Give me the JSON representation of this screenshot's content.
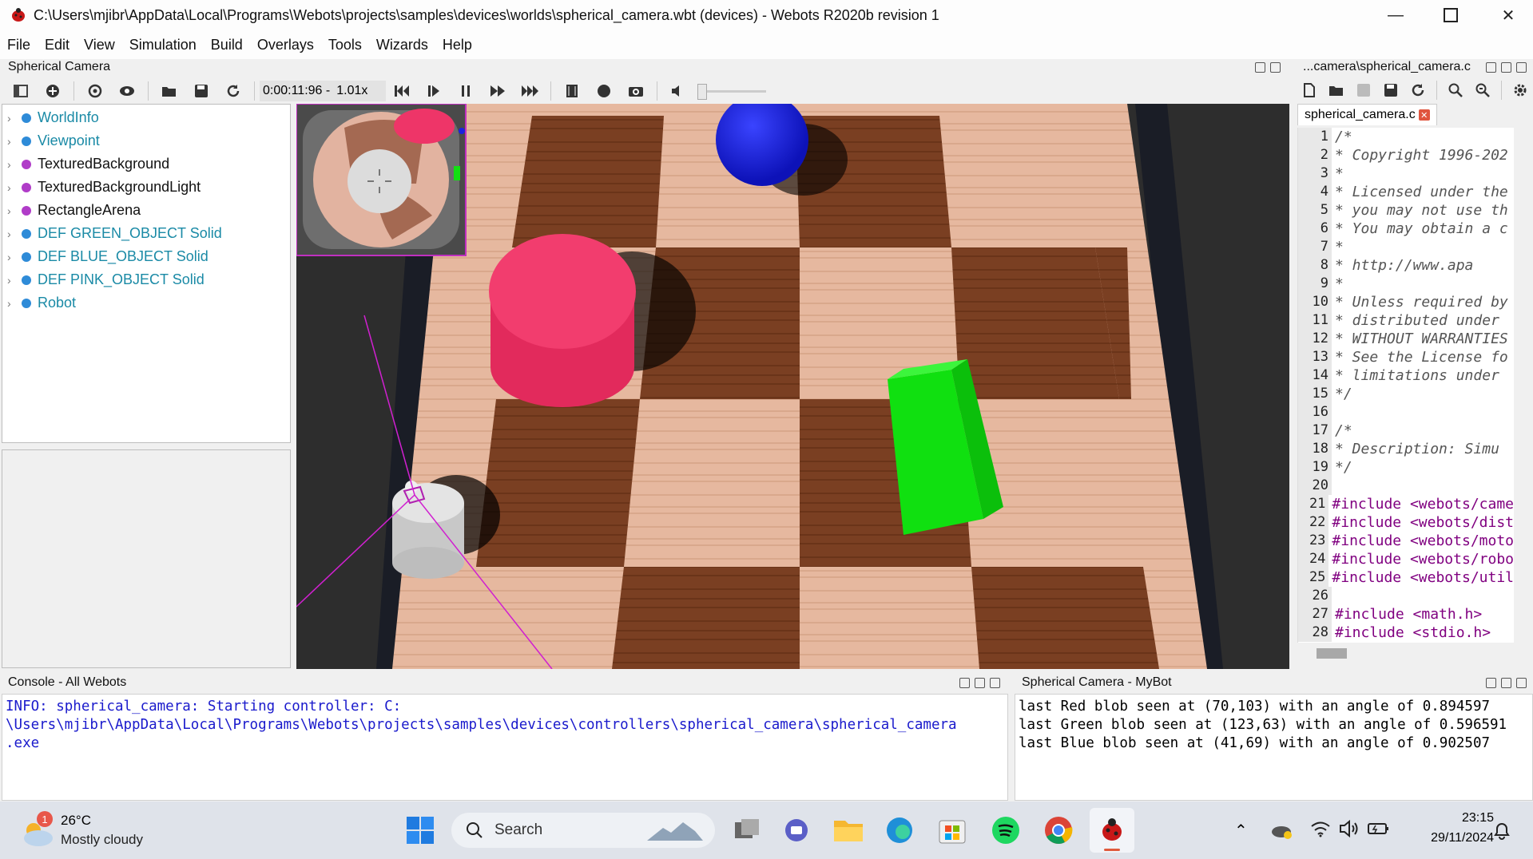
{
  "window": {
    "title": "C:\\Users\\mjibr\\AppData\\Local\\Programs\\Webots\\projects\\samples\\devices\\worlds\\spherical_camera.wbt (devices) - Webots R2020b revision 1",
    "minimize_icon": "minimize-icon",
    "maximize_icon": "maximize-icon",
    "close_icon": "close-icon"
  },
  "menu": [
    "File",
    "Edit",
    "View",
    "Simulation",
    "Build",
    "Overlays",
    "Tools",
    "Wizards",
    "Help"
  ],
  "scene_panel": {
    "title": "Spherical Camera",
    "sim_time": "0:00:11:96 -",
    "speed": "1.01x"
  },
  "scene_tree": [
    {
      "label": "WorldInfo",
      "color": "#1a8aa6",
      "dot": "#2e8bd8"
    },
    {
      "label": "Viewpoint",
      "color": "#1a8aa6",
      "dot": "#2e8bd8"
    },
    {
      "label": "TexturedBackground",
      "color": "#111111",
      "dot": "#b03cc8"
    },
    {
      "label": "TexturedBackgroundLight",
      "color": "#111111",
      "dot": "#b03cc8"
    },
    {
      "label": "RectangleArena",
      "color": "#111111",
      "dot": "#b03cc8"
    },
    {
      "label": "DEF GREEN_OBJECT Solid",
      "color": "#1a8aa6",
      "dot": "#2e8bd8"
    },
    {
      "label": "DEF BLUE_OBJECT Solid",
      "color": "#1a8aa6",
      "dot": "#2e8bd8"
    },
    {
      "label": "DEF PINK_OBJECT Solid",
      "color": "#1a8aa6",
      "dot": "#2e8bd8"
    },
    {
      "label": "Robot",
      "color": "#1a8aa6",
      "dot": "#2e8bd8"
    }
  ],
  "editor_panel": {
    "title": "...camera\\spherical_camera.c",
    "tab": "spherical_camera.c",
    "lines": [
      {
        "n": "1",
        "text": "/*",
        "kind": "comment"
      },
      {
        "n": "2",
        "text": " * Copyright 1996-202",
        "kind": "comment"
      },
      {
        "n": "3",
        "text": " *",
        "kind": "comment"
      },
      {
        "n": "4",
        "text": " * Licensed under the",
        "kind": "comment"
      },
      {
        "n": "5",
        "text": " * you may not use th",
        "kind": "comment"
      },
      {
        "n": "6",
        "text": " * You may obtain a c",
        "kind": "comment"
      },
      {
        "n": "7",
        "text": " *",
        "kind": "comment"
      },
      {
        "n": "8",
        "text": " *     http://www.apa",
        "kind": "comment"
      },
      {
        "n": "9",
        "text": " *",
        "kind": "comment"
      },
      {
        "n": "10",
        "text": " * Unless required by",
        "kind": "comment"
      },
      {
        "n": "11",
        "text": " * distributed under",
        "kind": "comment"
      },
      {
        "n": "12",
        "text": " * WITHOUT WARRANTIES",
        "kind": "comment"
      },
      {
        "n": "13",
        "text": " * See the License fo",
        "kind": "comment"
      },
      {
        "n": "14",
        "text": " * limitations under",
        "kind": "comment"
      },
      {
        "n": "15",
        "text": " */",
        "kind": "comment"
      },
      {
        "n": "16",
        "text": "",
        "kind": "comment"
      },
      {
        "n": "17",
        "text": "/*",
        "kind": "comment"
      },
      {
        "n": "18",
        "text": " * Description:  Simu",
        "kind": "comment"
      },
      {
        "n": "19",
        "text": " */",
        "kind": "comment"
      },
      {
        "n": "20",
        "text": "",
        "kind": "comment"
      },
      {
        "n": "21",
        "text": "#include <webots/came",
        "kind": "include"
      },
      {
        "n": "22",
        "text": "#include <webots/dist",
        "kind": "include"
      },
      {
        "n": "23",
        "text": "#include <webots/moto",
        "kind": "include"
      },
      {
        "n": "24",
        "text": "#include <webots/robo",
        "kind": "include"
      },
      {
        "n": "25",
        "text": "#include <webots/util",
        "kind": "include"
      },
      {
        "n": "26",
        "text": "",
        "kind": "comment"
      },
      {
        "n": "27",
        "text": "#include <math.h>",
        "kind": "include"
      },
      {
        "n": "28",
        "text": "#include <stdio.h>",
        "kind": "include"
      }
    ]
  },
  "console_all": {
    "title": "Console - All Webots",
    "lines": [
      "INFO: spherical_camera: Starting controller: C:",
      "\\Users\\mjibr\\AppData\\Local\\Programs\\Webots\\projects\\samples\\devices\\controllers\\spherical_camera\\spherical_camera",
      ".exe"
    ],
    "color": "#1a1acc"
  },
  "console_robot": {
    "title": "Spherical Camera - MyBot",
    "lines": [
      "last Red blob seen at (70,103) with an angle of 0.894597",
      "last Green blob seen at (123,63) with an angle of 0.596591",
      "last Blue blob seen at (41,69) with an angle of 0.902507"
    ]
  },
  "taskbar": {
    "weather_temp": "26°C",
    "weather_desc": "Mostly cloudy",
    "weather_badge": "1",
    "search_label": "Search",
    "time": "23:15",
    "date": "29/11/2024"
  },
  "colors": {
    "pink_object": "#ee3568",
    "blue_object": "#1a22e0",
    "green_object": "#12e012",
    "tree_link": "#1a8aa6"
  }
}
